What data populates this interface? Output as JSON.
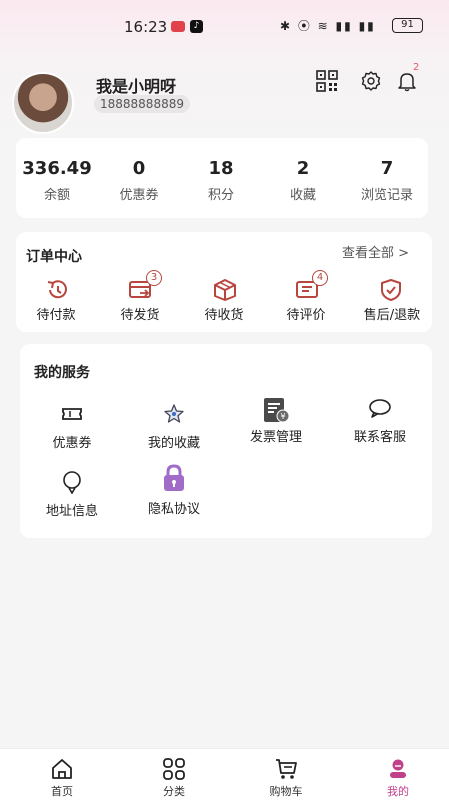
{
  "status_bar": {
    "time": "16:23",
    "battery": "91"
  },
  "profile": {
    "name": "我是小明呀",
    "phone": "18888888889",
    "notification_count": "2"
  },
  "stats": [
    {
      "value": "336.49",
      "label": "余额"
    },
    {
      "value": "0",
      "label": "优惠券"
    },
    {
      "value": "18",
      "label": "积分"
    },
    {
      "value": "2",
      "label": "收藏"
    },
    {
      "value": "7",
      "label": "浏览记录"
    }
  ],
  "orders": {
    "title": "订单中心",
    "view_all": "查看全部 >",
    "items": [
      {
        "label": "待付款",
        "icon": "clock-back-icon"
      },
      {
        "label": "待发货",
        "icon": "card-arrow-icon",
        "badge": "3"
      },
      {
        "label": "待收货",
        "icon": "box-icon"
      },
      {
        "label": "待评价",
        "icon": "chat-lines-icon",
        "badge": "4"
      },
      {
        "label": "售后/退款",
        "icon": "shield-check-icon"
      }
    ]
  },
  "services": {
    "title": "我的服务",
    "items": [
      {
        "label": "优惠券",
        "icon": "ticket-icon"
      },
      {
        "label": "我的收藏",
        "icon": "star-icon"
      },
      {
        "label": "发票管理",
        "icon": "invoice-icon"
      },
      {
        "label": "联系客服",
        "icon": "speech-bubble-icon"
      },
      {
        "label": "地址信息",
        "icon": "location-pin-icon"
      },
      {
        "label": "隐私协议",
        "icon": "lock-icon"
      }
    ]
  },
  "bottom_nav": [
    {
      "label": "首页",
      "icon": "home-icon"
    },
    {
      "label": "分类",
      "icon": "grid-icon"
    },
    {
      "label": "购物车",
      "icon": "cart-icon"
    },
    {
      "label": "我的",
      "icon": "profile-icon",
      "active": true
    }
  ],
  "colors": {
    "accent": "#c0408a",
    "order_icon": "#b8453e",
    "lock_bg": "#a06cc8"
  }
}
